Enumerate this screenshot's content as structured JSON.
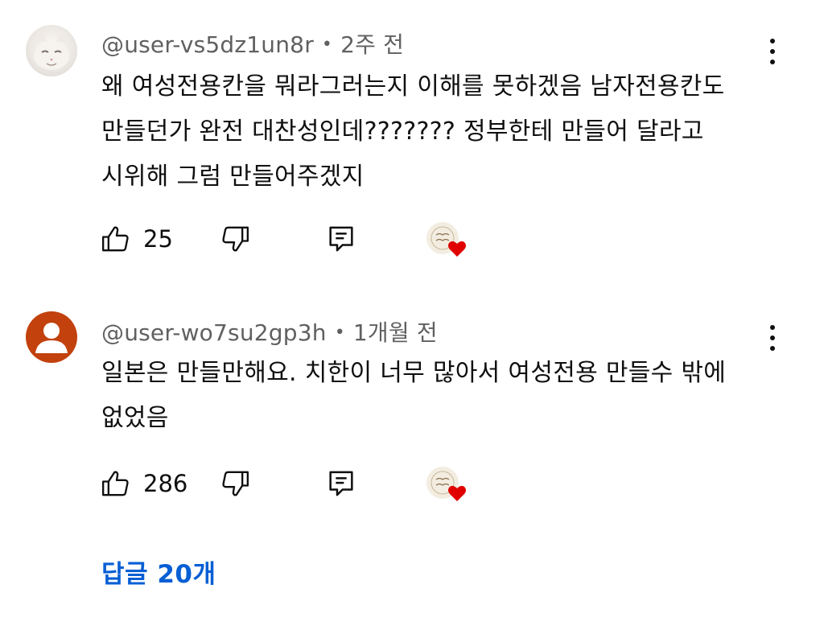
{
  "comments": [
    {
      "author": "@user-vs5dz1un8r",
      "time": "2주 전",
      "text": "왜 여성전용칸을 뭐라그러는지 이해를 못하겠음 남자전용칸도 만들던가 완전 대찬성인데??????? 정부한테 만들어 달라고 시위해 그럼 만들어주겠지",
      "likes": "25",
      "avatar": "cat-photo"
    },
    {
      "author": "@user-wo7su2gp3h",
      "time": "1개월 전",
      "text": "일본은 만들만해요. 치한이 너무 많아서 여성전용 만들수 밖에 없었음",
      "likes": "286",
      "avatar": "default-person-icon"
    }
  ],
  "meta_separator": "•",
  "replies_label": "답글 20개",
  "colors": {
    "replies_link": "#065fd4",
    "meta_text": "#606060",
    "heart": "#e00000",
    "default_avatar": "#c2410c"
  },
  "icons": [
    "thumbs-up-icon",
    "thumbs-down-icon",
    "reply-icon",
    "creator-heart-icon",
    "more-vert-icon"
  ]
}
